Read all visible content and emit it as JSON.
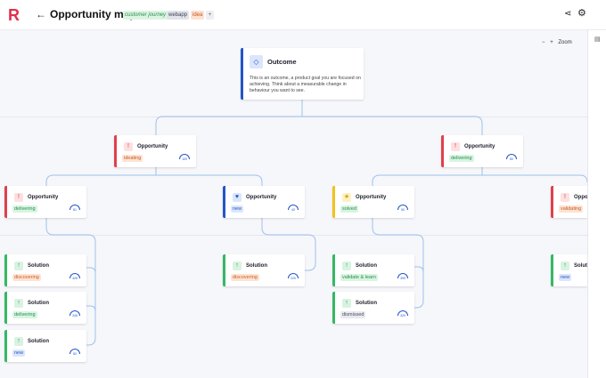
{
  "header": {
    "logo": "R",
    "back_glyph": "←",
    "title": "Opportunity map",
    "tags": [
      "customer journey",
      "webapp",
      "idea"
    ],
    "add_tag": "+",
    "share_glyph": "⋖",
    "settings_glyph": "⚙"
  },
  "zoom": {
    "minus": "−",
    "plus": "+",
    "label": "Zoom"
  },
  "side_panel": {
    "toggle_glyph": "▤"
  },
  "outcome": {
    "label": "Outcome",
    "icon": "◇",
    "description": "This is an outcome, a product goal you are focused on achieving. Think about a measurable change in behaviour you want to see."
  },
  "cards": [
    {
      "kind": "opportunity",
      "label": "Opportunity",
      "status": "ideating",
      "status_color": "orange",
      "accent": "red",
      "icon": "!",
      "gauge": "100"
    },
    {
      "kind": "opportunity",
      "label": "Opportunity",
      "status": "delivering",
      "status_color": "green",
      "accent": "red",
      "icon": "!",
      "gauge": "80"
    },
    {
      "kind": "opportunity",
      "label": "Opportunity",
      "status": "delivering",
      "status_color": "green",
      "accent": "red",
      "icon": "!",
      "gauge": "81"
    },
    {
      "kind": "opportunity",
      "label": "Opportunity",
      "status": "new",
      "status_color": "blue",
      "accent": "blue",
      "icon": "♥",
      "gauge": "40"
    },
    {
      "kind": "opportunity",
      "label": "Opportunity",
      "status": "solved",
      "status_color": "green",
      "accent": "yellow",
      "icon": "★",
      "gauge": "50"
    },
    {
      "kind": "opportunity",
      "label": "Opportunity",
      "status": "validating",
      "status_color": "orange",
      "accent": "red",
      "icon": "!",
      "gauge": ""
    },
    {
      "kind": "solution",
      "label": "Solution",
      "status": "discovering",
      "status_color": "orange",
      "accent": "green",
      "icon": "↑",
      "gauge": "426"
    },
    {
      "kind": "solution",
      "label": "Solution",
      "status": "delivering",
      "status_color": "green",
      "accent": "green",
      "icon": "↑",
      "gauge": "345"
    },
    {
      "kind": "solution",
      "label": "Solution",
      "status": "new",
      "status_color": "blue",
      "accent": "green",
      "icon": "↑",
      "gauge": "80"
    },
    {
      "kind": "solution",
      "label": "Solution",
      "status": "discovering",
      "status_color": "orange",
      "accent": "green",
      "icon": "↑",
      "gauge": "220"
    },
    {
      "kind": "solution",
      "label": "Solution",
      "status": "validate & learn",
      "status_color": "green",
      "accent": "green",
      "icon": "↑",
      "gauge": "399"
    },
    {
      "kind": "solution",
      "label": "Solution",
      "status": "dismissed",
      "status_color": "gray",
      "accent": "green",
      "icon": "↑",
      "gauge": "329"
    },
    {
      "kind": "solution",
      "label": "Solution",
      "status": "new",
      "status_color": "blue",
      "accent": "green",
      "icon": "↑",
      "gauge": ""
    }
  ],
  "colors": {
    "brand": "#e0304b",
    "connector": "#9fc0ec",
    "canvas": "#f6f7fa"
  }
}
